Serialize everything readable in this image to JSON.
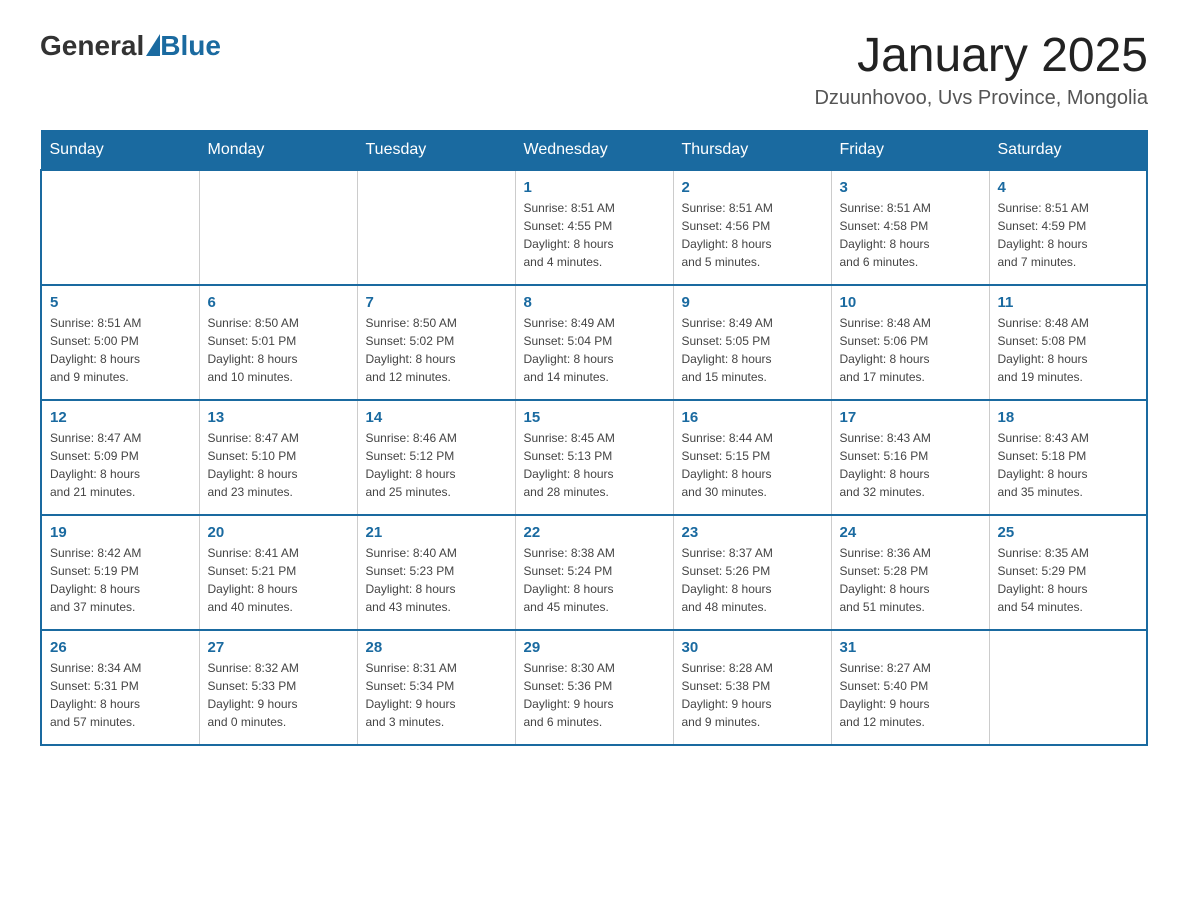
{
  "header": {
    "logo_general": "General",
    "logo_blue": "Blue",
    "title": "January 2025",
    "subtitle": "Dzuunhovoo, Uvs Province, Mongolia"
  },
  "weekdays": [
    "Sunday",
    "Monday",
    "Tuesday",
    "Wednesday",
    "Thursday",
    "Friday",
    "Saturday"
  ],
  "weeks": [
    [
      {
        "day": "",
        "info": ""
      },
      {
        "day": "",
        "info": ""
      },
      {
        "day": "",
        "info": ""
      },
      {
        "day": "1",
        "info": "Sunrise: 8:51 AM\nSunset: 4:55 PM\nDaylight: 8 hours\nand 4 minutes."
      },
      {
        "day": "2",
        "info": "Sunrise: 8:51 AM\nSunset: 4:56 PM\nDaylight: 8 hours\nand 5 minutes."
      },
      {
        "day": "3",
        "info": "Sunrise: 8:51 AM\nSunset: 4:58 PM\nDaylight: 8 hours\nand 6 minutes."
      },
      {
        "day": "4",
        "info": "Sunrise: 8:51 AM\nSunset: 4:59 PM\nDaylight: 8 hours\nand 7 minutes."
      }
    ],
    [
      {
        "day": "5",
        "info": "Sunrise: 8:51 AM\nSunset: 5:00 PM\nDaylight: 8 hours\nand 9 minutes."
      },
      {
        "day": "6",
        "info": "Sunrise: 8:50 AM\nSunset: 5:01 PM\nDaylight: 8 hours\nand 10 minutes."
      },
      {
        "day": "7",
        "info": "Sunrise: 8:50 AM\nSunset: 5:02 PM\nDaylight: 8 hours\nand 12 minutes."
      },
      {
        "day": "8",
        "info": "Sunrise: 8:49 AM\nSunset: 5:04 PM\nDaylight: 8 hours\nand 14 minutes."
      },
      {
        "day": "9",
        "info": "Sunrise: 8:49 AM\nSunset: 5:05 PM\nDaylight: 8 hours\nand 15 minutes."
      },
      {
        "day": "10",
        "info": "Sunrise: 8:48 AM\nSunset: 5:06 PM\nDaylight: 8 hours\nand 17 minutes."
      },
      {
        "day": "11",
        "info": "Sunrise: 8:48 AM\nSunset: 5:08 PM\nDaylight: 8 hours\nand 19 minutes."
      }
    ],
    [
      {
        "day": "12",
        "info": "Sunrise: 8:47 AM\nSunset: 5:09 PM\nDaylight: 8 hours\nand 21 minutes."
      },
      {
        "day": "13",
        "info": "Sunrise: 8:47 AM\nSunset: 5:10 PM\nDaylight: 8 hours\nand 23 minutes."
      },
      {
        "day": "14",
        "info": "Sunrise: 8:46 AM\nSunset: 5:12 PM\nDaylight: 8 hours\nand 25 minutes."
      },
      {
        "day": "15",
        "info": "Sunrise: 8:45 AM\nSunset: 5:13 PM\nDaylight: 8 hours\nand 28 minutes."
      },
      {
        "day": "16",
        "info": "Sunrise: 8:44 AM\nSunset: 5:15 PM\nDaylight: 8 hours\nand 30 minutes."
      },
      {
        "day": "17",
        "info": "Sunrise: 8:43 AM\nSunset: 5:16 PM\nDaylight: 8 hours\nand 32 minutes."
      },
      {
        "day": "18",
        "info": "Sunrise: 8:43 AM\nSunset: 5:18 PM\nDaylight: 8 hours\nand 35 minutes."
      }
    ],
    [
      {
        "day": "19",
        "info": "Sunrise: 8:42 AM\nSunset: 5:19 PM\nDaylight: 8 hours\nand 37 minutes."
      },
      {
        "day": "20",
        "info": "Sunrise: 8:41 AM\nSunset: 5:21 PM\nDaylight: 8 hours\nand 40 minutes."
      },
      {
        "day": "21",
        "info": "Sunrise: 8:40 AM\nSunset: 5:23 PM\nDaylight: 8 hours\nand 43 minutes."
      },
      {
        "day": "22",
        "info": "Sunrise: 8:38 AM\nSunset: 5:24 PM\nDaylight: 8 hours\nand 45 minutes."
      },
      {
        "day": "23",
        "info": "Sunrise: 8:37 AM\nSunset: 5:26 PM\nDaylight: 8 hours\nand 48 minutes."
      },
      {
        "day": "24",
        "info": "Sunrise: 8:36 AM\nSunset: 5:28 PM\nDaylight: 8 hours\nand 51 minutes."
      },
      {
        "day": "25",
        "info": "Sunrise: 8:35 AM\nSunset: 5:29 PM\nDaylight: 8 hours\nand 54 minutes."
      }
    ],
    [
      {
        "day": "26",
        "info": "Sunrise: 8:34 AM\nSunset: 5:31 PM\nDaylight: 8 hours\nand 57 minutes."
      },
      {
        "day": "27",
        "info": "Sunrise: 8:32 AM\nSunset: 5:33 PM\nDaylight: 9 hours\nand 0 minutes."
      },
      {
        "day": "28",
        "info": "Sunrise: 8:31 AM\nSunset: 5:34 PM\nDaylight: 9 hours\nand 3 minutes."
      },
      {
        "day": "29",
        "info": "Sunrise: 8:30 AM\nSunset: 5:36 PM\nDaylight: 9 hours\nand 6 minutes."
      },
      {
        "day": "30",
        "info": "Sunrise: 8:28 AM\nSunset: 5:38 PM\nDaylight: 9 hours\nand 9 minutes."
      },
      {
        "day": "31",
        "info": "Sunrise: 8:27 AM\nSunset: 5:40 PM\nDaylight: 9 hours\nand 12 minutes."
      },
      {
        "day": "",
        "info": ""
      }
    ]
  ]
}
